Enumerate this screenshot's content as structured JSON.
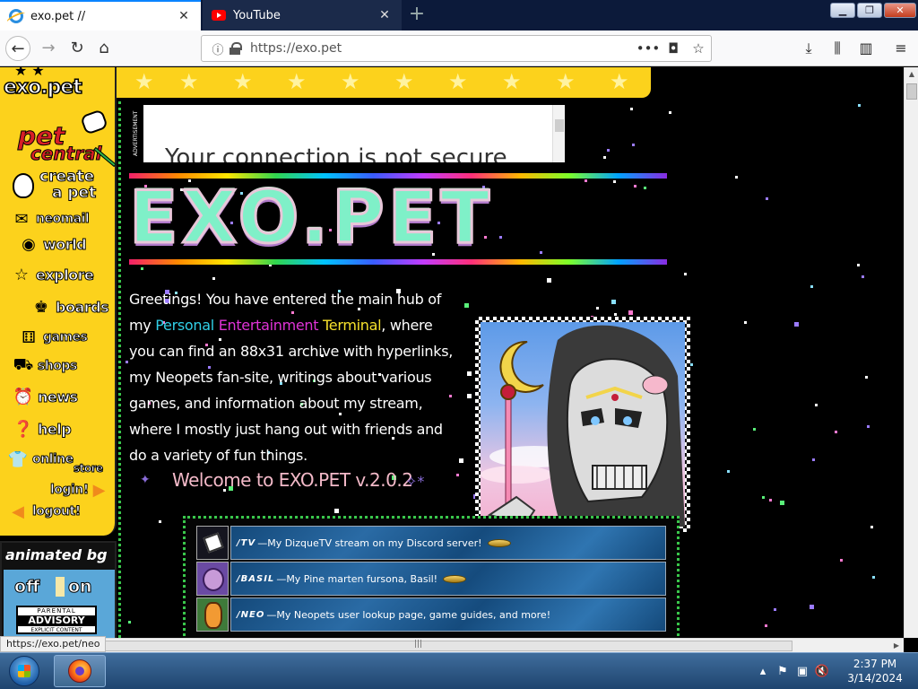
{
  "browser": {
    "tabs": [
      {
        "title": "exo.pet //",
        "icon": "ie-icon",
        "active": true
      },
      {
        "title": "YouTube",
        "icon": "youtube-icon",
        "active": false
      }
    ],
    "url": "https://exo.pet",
    "status_url": "https://exo.pet/neo"
  },
  "site": {
    "logo": "exo.pet",
    "pet_central": {
      "line1": "pet",
      "line2": "central"
    },
    "create_pet": {
      "line1": "create",
      "line2": "a pet"
    },
    "nav": [
      {
        "label": "neomail",
        "icon": "envelope-icon"
      },
      {
        "label": "world",
        "icon": "globe-icon"
      },
      {
        "label": "explore",
        "icon": "star-icon"
      },
      {
        "label": "boards",
        "icon": "boards-icon"
      },
      {
        "label": "games",
        "icon": "dice-icon"
      },
      {
        "label": "shops",
        "icon": "cart-icon"
      },
      {
        "label": "news",
        "icon": "alarm-clock-icon"
      },
      {
        "label": "help",
        "icon": "help-icon"
      },
      {
        "label": "online",
        "icon": "tshirt-icon"
      },
      {
        "label": "store",
        "icon": ""
      },
      {
        "label": "login!",
        "icon": "arrow-right-icon"
      },
      {
        "label": "logout!",
        "icon": "arrow-left-icon"
      }
    ],
    "animated_bg": {
      "title": "animated bg",
      "off": "off",
      "on": "on"
    },
    "advisory": {
      "line1": "PARENTAL",
      "line2": "ADVISORY",
      "line3": "EXPLICIT CONTENT"
    },
    "ad": {
      "label": "ADVERTISEMENT",
      "text": "Your connection is not secure"
    },
    "title": "EXO.PET",
    "intro": {
      "p1": "Greetings! You have entered the main hub of my",
      "w1": "Personal",
      "w2": "Entertainment",
      "w3": "Terminal",
      "p2": ", where you can find an 88x31 archive with hyperlinks, my Neopets fan-site, writings about various games, and information about my stream, where I mostly just hang out with friends and do a variety of fun things."
    },
    "welcome": "Welcome to EXO.PET v.2.0.2",
    "links": [
      {
        "path": "/TV",
        "desc": "—My DizqueTV stream on my Discord server!",
        "badge": true
      },
      {
        "path": "/BASIL",
        "desc": "—My Pine marten fursona, Basil!",
        "badge": true
      },
      {
        "path": "/NEO",
        "desc": "—My Neopets user lookup page, game guides, and more!",
        "badge": false
      }
    ]
  },
  "taskbar": {
    "time": "2:37 PM",
    "date": "3/14/2024"
  },
  "colors": {
    "yellow": "#fcd21c",
    "green_border": "#39c74b",
    "cyan": "#31d0e8",
    "magenta": "#e033d8",
    "text_yellow": "#f7e22c"
  }
}
